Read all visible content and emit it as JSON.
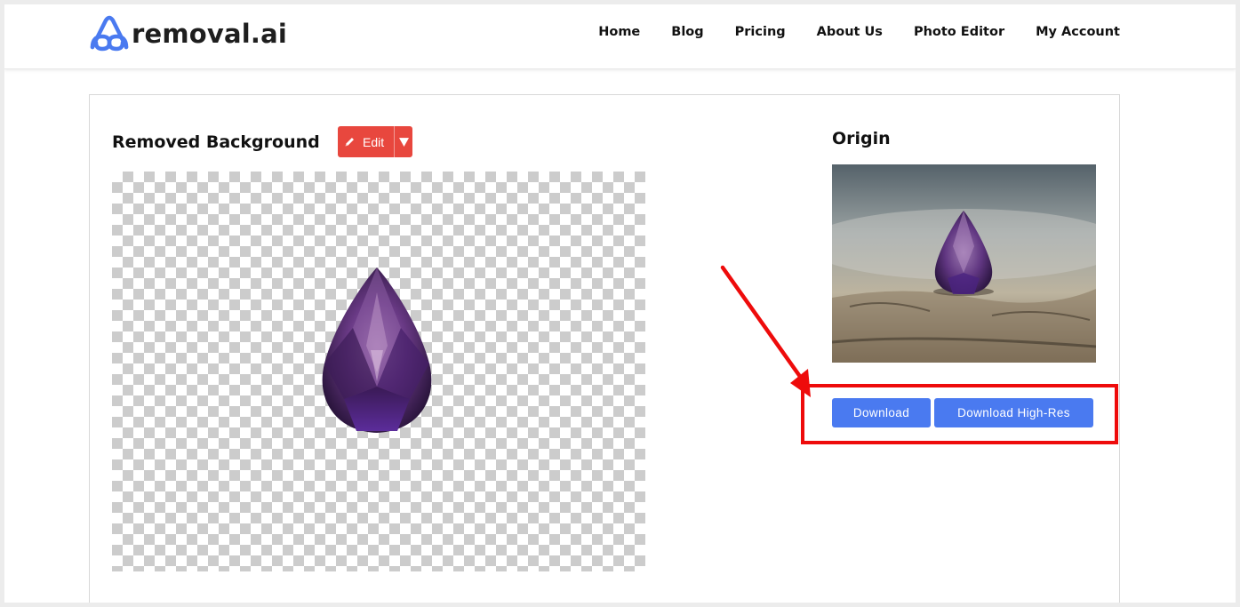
{
  "header": {
    "logo_text": "removal.ai",
    "logo_icon": "removal-logo-icon",
    "nav": [
      "Home",
      "Blog",
      "Pricing",
      "About Us",
      "Photo Editor",
      "My Account"
    ]
  },
  "result": {
    "title": "Removed Background",
    "edit_label": "Edit",
    "edit_icon": "pencil-icon",
    "dropdown_icon": "caret-down-icon"
  },
  "origin": {
    "title": "Origin",
    "download_label": "Download",
    "download_hires_label": "Download High-Res"
  },
  "colors": {
    "brand_blue": "#4a7af0",
    "edit_red": "#e8473e",
    "annotation_red": "#ee0b0b",
    "gem_purple": "#4b1f6e"
  }
}
